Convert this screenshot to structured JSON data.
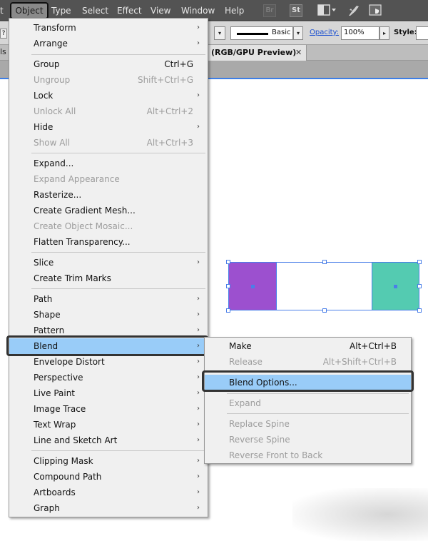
{
  "menubar": {
    "partial_left": "t",
    "items": [
      "Object",
      "Type",
      "Select",
      "Effect",
      "View",
      "Window",
      "Help"
    ],
    "bridge_icon": "Br",
    "stock_icon": "St"
  },
  "controlbar": {
    "question": "?",
    "stroke_profile": "Basic",
    "opacity_label": "Opacity:",
    "opacity_value": "100%",
    "style_label": "Style:"
  },
  "tabbar": {
    "left_text": "ls",
    "doc_tab": "(RGB/GPU Preview)",
    "close": "✕"
  },
  "object_menu": {
    "items": [
      {
        "label": "Transform",
        "shortcut": "",
        "submenu": true,
        "disabled": false
      },
      {
        "label": "Arrange",
        "shortcut": "",
        "submenu": true,
        "disabled": false
      },
      {
        "label": "Group",
        "shortcut": "Ctrl+G",
        "submenu": false,
        "disabled": false
      },
      {
        "label": "Ungroup",
        "shortcut": "Shift+Ctrl+G",
        "submenu": false,
        "disabled": true
      },
      {
        "label": "Lock",
        "shortcut": "",
        "submenu": true,
        "disabled": false
      },
      {
        "label": "Unlock All",
        "shortcut": "Alt+Ctrl+2",
        "submenu": false,
        "disabled": true
      },
      {
        "label": "Hide",
        "shortcut": "",
        "submenu": true,
        "disabled": false
      },
      {
        "label": "Show All",
        "shortcut": "Alt+Ctrl+3",
        "submenu": false,
        "disabled": true
      },
      {
        "label": "Expand...",
        "shortcut": "",
        "submenu": false,
        "disabled": false
      },
      {
        "label": "Expand Appearance",
        "shortcut": "",
        "submenu": false,
        "disabled": true
      },
      {
        "label": "Rasterize...",
        "shortcut": "",
        "submenu": false,
        "disabled": false
      },
      {
        "label": "Create Gradient Mesh...",
        "shortcut": "",
        "submenu": false,
        "disabled": false
      },
      {
        "label": "Create Object Mosaic...",
        "shortcut": "",
        "submenu": false,
        "disabled": true
      },
      {
        "label": "Flatten Transparency...",
        "shortcut": "",
        "submenu": false,
        "disabled": false
      },
      {
        "label": "Slice",
        "shortcut": "",
        "submenu": true,
        "disabled": false
      },
      {
        "label": "Create Trim Marks",
        "shortcut": "",
        "submenu": false,
        "disabled": false
      },
      {
        "label": "Path",
        "shortcut": "",
        "submenu": true,
        "disabled": false
      },
      {
        "label": "Shape",
        "shortcut": "",
        "submenu": true,
        "disabled": false
      },
      {
        "label": "Pattern",
        "shortcut": "",
        "submenu": true,
        "disabled": false
      },
      {
        "label": "Blend",
        "shortcut": "",
        "submenu": true,
        "disabled": false
      },
      {
        "label": "Envelope Distort",
        "shortcut": "",
        "submenu": true,
        "disabled": false
      },
      {
        "label": "Perspective",
        "shortcut": "",
        "submenu": true,
        "disabled": false
      },
      {
        "label": "Live Paint",
        "shortcut": "",
        "submenu": true,
        "disabled": false
      },
      {
        "label": "Image Trace",
        "shortcut": "",
        "submenu": true,
        "disabled": false
      },
      {
        "label": "Text Wrap",
        "shortcut": "",
        "submenu": true,
        "disabled": false
      },
      {
        "label": "Line and Sketch Art",
        "shortcut": "",
        "submenu": true,
        "disabled": false
      },
      {
        "label": "Clipping Mask",
        "shortcut": "",
        "submenu": true,
        "disabled": false
      },
      {
        "label": "Compound Path",
        "shortcut": "",
        "submenu": true,
        "disabled": false
      },
      {
        "label": "Artboards",
        "shortcut": "",
        "submenu": true,
        "disabled": false
      },
      {
        "label": "Graph",
        "shortcut": "",
        "submenu": true,
        "disabled": false
      }
    ]
  },
  "blend_menu": {
    "items": [
      {
        "label": "Make",
        "shortcut": "Alt+Ctrl+B",
        "disabled": false
      },
      {
        "label": "Release",
        "shortcut": "Alt+Shift+Ctrl+B",
        "disabled": true
      },
      {
        "label": "Blend Options...",
        "shortcut": "",
        "disabled": false
      },
      {
        "label": "Expand",
        "shortcut": "",
        "disabled": true
      },
      {
        "label": "Replace Spine",
        "shortcut": "",
        "disabled": true
      },
      {
        "label": "Reverse Spine",
        "shortcut": "",
        "disabled": true
      },
      {
        "label": "Reverse Front to Back",
        "shortcut": "",
        "disabled": true
      }
    ]
  },
  "colors": {
    "highlight": "#99ccf8",
    "purple_square": "#9c50cf",
    "teal_square": "#54cbb1",
    "selection": "#4a7fe8"
  },
  "arrow_glyph": "›"
}
